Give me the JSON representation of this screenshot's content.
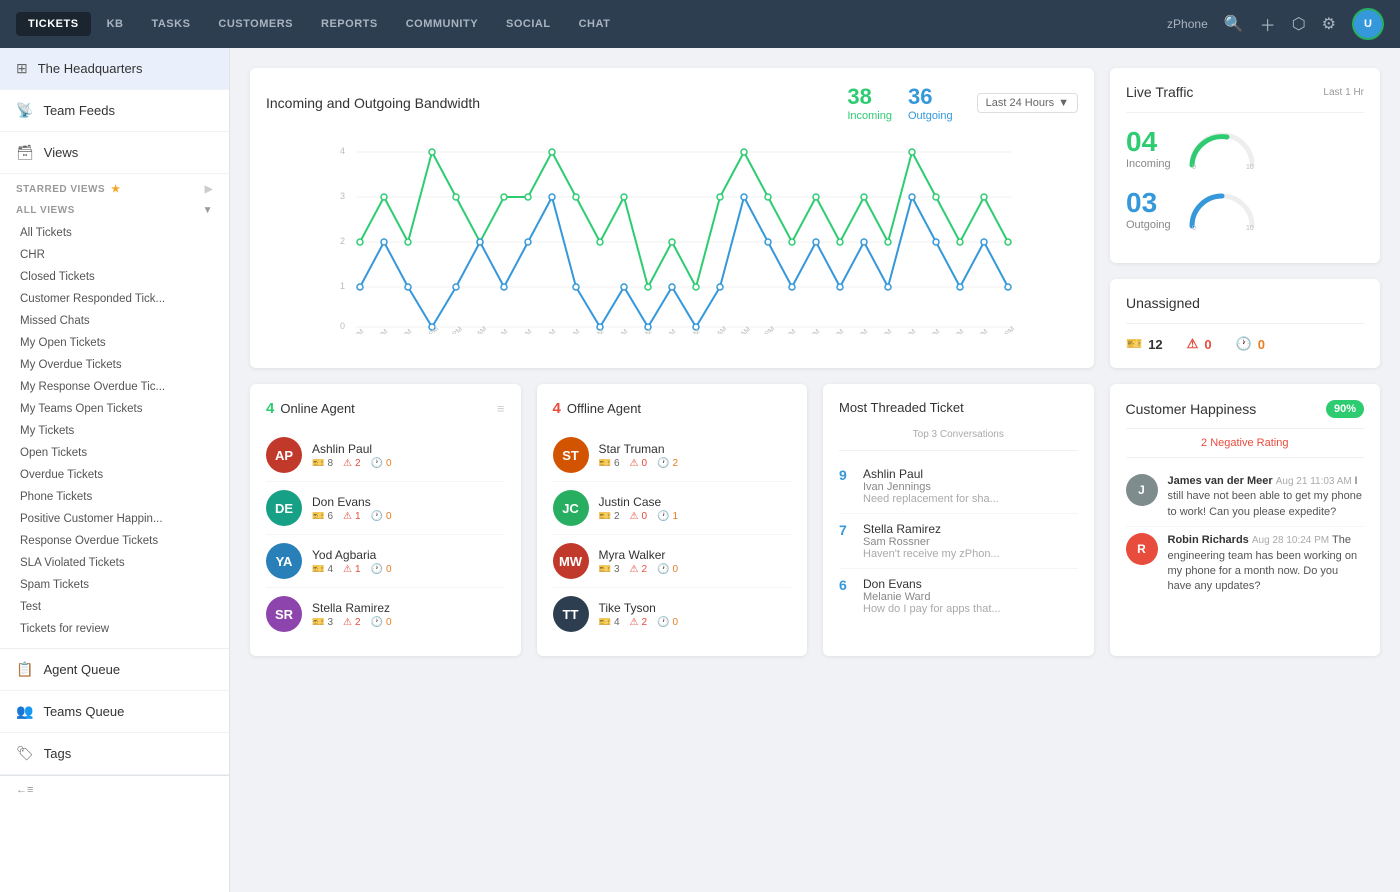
{
  "nav": {
    "items": [
      {
        "label": "TICKETS",
        "active": true
      },
      {
        "label": "KB",
        "active": false
      },
      {
        "label": "TASKS",
        "active": false
      },
      {
        "label": "CUSTOMERS",
        "active": false
      },
      {
        "label": "REPORTS",
        "active": false
      },
      {
        "label": "COMMUNITY",
        "active": false
      },
      {
        "label": "SOCIAL",
        "active": false
      },
      {
        "label": "CHAT",
        "active": false
      }
    ],
    "phone_label": "zPhone",
    "avatar_initials": "U"
  },
  "sidebar": {
    "main_items": [
      {
        "icon": "⊞",
        "label": "The Headquarters",
        "active": true
      },
      {
        "icon": "📡",
        "label": "Team Feeds",
        "active": false
      },
      {
        "icon": "🗃",
        "label": "Views",
        "active": false
      }
    ],
    "starred_label": "STARRED VIEWS",
    "all_views_label": "ALL VIEWS",
    "links": [
      "All Tickets",
      "CHR",
      "Closed Tickets",
      "Customer Responded Tick...",
      "Missed Chats",
      "My Open Tickets",
      "My Overdue Tickets",
      "My Response Overdue Tic...",
      "My Teams Open Tickets",
      "My Tickets",
      "Open Tickets",
      "Overdue Tickets",
      "Phone Tickets",
      "Positive Customer Happin...",
      "Response Overdue Tickets",
      "SLA Violated Tickets",
      "Spam Tickets",
      "Test",
      "Tickets for review"
    ],
    "bottom_items": [
      {
        "icon": "📋",
        "label": "Agent Queue"
      },
      {
        "icon": "👥",
        "label": "Teams Queue"
      },
      {
        "icon": "🏷",
        "label": "Tags"
      }
    ]
  },
  "bandwidth": {
    "title": "Incoming and Outgoing Bandwidth",
    "filter": "Last 24 Hours",
    "incoming_count": "38",
    "incoming_label": "Incoming",
    "outgoing_count": "36",
    "outgoing_label": "Outgoing",
    "x_labels": [
      "7PM",
      "8PM",
      "9PM",
      "10PM",
      "11PM",
      "12AM",
      "1AM",
      "2AM",
      "3AM",
      "4AM",
      "5AM",
      "6AM",
      "7AM",
      "8AM",
      "9AM",
      "10AM",
      "11AM",
      "12PM",
      "1PM",
      "2PM",
      "3PM",
      "4PM",
      "5PM",
      "6PM",
      "7PM",
      "8PM",
      "9PM",
      "10PM"
    ]
  },
  "online_agents": {
    "count": "4",
    "label": "Online Agent",
    "agents": [
      {
        "name": "Ashlin Paul",
        "tickets": "8",
        "overdue": "2",
        "open": "0",
        "color": "#c0392b",
        "initials": "AP"
      },
      {
        "name": "Don Evans",
        "tickets": "6",
        "overdue": "1",
        "open": "0",
        "color": "#16a085",
        "initials": "DE"
      },
      {
        "name": "Yod Agbaria",
        "tickets": "4",
        "overdue": "1",
        "open": "0",
        "color": "#2980b9",
        "initials": "YA"
      },
      {
        "name": "Stella Ramirez",
        "tickets": "3",
        "overdue": "2",
        "open": "0",
        "color": "#8e44ad",
        "initials": "SR"
      }
    ]
  },
  "offline_agents": {
    "count": "4",
    "label": "Offline Agent",
    "agents": [
      {
        "name": "Star Truman",
        "tickets": "6",
        "overdue": "0",
        "open": "2",
        "color": "#d35400",
        "initials": "ST"
      },
      {
        "name": "Justin Case",
        "tickets": "2",
        "overdue": "0",
        "open": "1",
        "color": "#27ae60",
        "initials": "JC"
      },
      {
        "name": "Myra Walker",
        "tickets": "3",
        "overdue": "2",
        "open": "0",
        "color": "#c0392b",
        "initials": "MW"
      },
      {
        "name": "Tike Tyson",
        "tickets": "4",
        "overdue": "2",
        "open": "0",
        "color": "#2c3e50",
        "initials": "TT"
      }
    ]
  },
  "most_threaded": {
    "title": "Most Threaded Ticket",
    "top_label": "Top 3 Conversations",
    "items": [
      {
        "num": "9",
        "name": "Ashlin Paul",
        "sub": "Ivan Jennings",
        "preview": "Need replacement for sha..."
      },
      {
        "num": "7",
        "name": "Stella Ramirez",
        "sub": "Sam Rossner",
        "preview": "Haven't receive my zPhon..."
      },
      {
        "num": "6",
        "name": "Don Evans",
        "sub": "Melanie Ward",
        "preview": "How do I pay for apps that..."
      }
    ]
  },
  "live_traffic": {
    "title": "Live Traffic",
    "sub": "Last 1 Hr",
    "incoming_num": "04",
    "incoming_label": "Incoming",
    "outgoing_num": "03",
    "outgoing_label": "Outgoing"
  },
  "unassigned": {
    "title": "Unassigned",
    "ticket_count": "12",
    "urgent_count": "0",
    "overdue_count": "0"
  },
  "customer_happiness": {
    "title": "Customer Happiness",
    "percentage": "90%",
    "negative_label": "2 Negative Rating",
    "reviews": [
      {
        "author": "James van der Meer",
        "time": "Aug 21 11:03 AM",
        "text": "I still have not been able to get my phone to work! Can you please expedite?",
        "initials": "J",
        "color": "#7f8c8d"
      },
      {
        "author": "Robin Richards",
        "time": "Aug 28 10:24 PM",
        "text": "The engineering team has been working on my phone for a month now. Do you have any updates?",
        "initials": "R",
        "color": "#e74c3c"
      }
    ]
  }
}
